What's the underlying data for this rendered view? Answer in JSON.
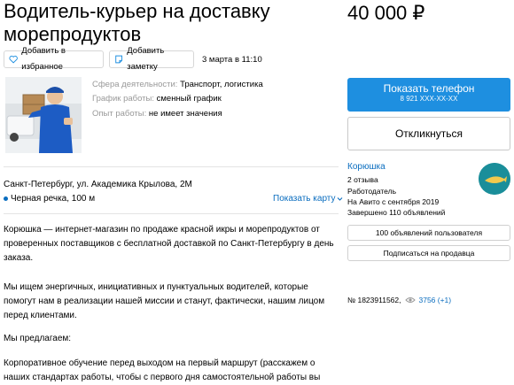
{
  "listing": {
    "title": "Водитель-курьер на доставку морепродуктов",
    "price": "40 000 ₽",
    "favorite_label": "Добавить в избранное",
    "note_label": "Добавить заметку",
    "date": "3 марта в 11:10"
  },
  "params": [
    {
      "key": "Сфера деятельности:",
      "value": "Транспорт, логистика"
    },
    {
      "key": "График работы:",
      "value": "сменный график"
    },
    {
      "key": "Опыт работы:",
      "value": "не имеет значения"
    }
  ],
  "location": {
    "address": "Санкт-Петербург, ул. Академика Крылова, 2М",
    "metro": "Черная речка, 100 м",
    "map_link": "Показать карту",
    "metro_color": "#0a6dbf"
  },
  "description": [
    "Корюшка — интернет-магазин по продаже красной икры и морепродуктов от проверенных поставщиков с бесплатной доставкой по Санкт-Петербургу в день заказа.",
    "Мы ищем энергичных, инициативных и пунктуальных водителей, которые помогут нам в реализации нашей миссии и станут, фактически, нашим лицом перед клиентами.",
    "Мы предлагаем:",
    "Корпоративное обучение перед выходом на первый маршрут (расскажем о наших стандартах работы, чтобы с первого дня самостоятельной работы вы могли"
  ],
  "contact": {
    "phone_label": "Показать телефон",
    "phone_number": "8 921 XXX-XX-XX",
    "respond_label": "Откликнуться",
    "accent": "#1e8fe0"
  },
  "seller": {
    "name": "Корюшка",
    "reviews": "2 отзыва",
    "role": "Работодатель",
    "since": "На Авито с сентября 2019",
    "completed": "Завершено 110 объявлений",
    "all_ads": "100 объявлений пользователя",
    "subscribe": "Подписаться на продавца",
    "logo_text": "Корюшка"
  },
  "stats": {
    "ad_number": "№ 1823911562,",
    "views": "3756 (+1)"
  }
}
